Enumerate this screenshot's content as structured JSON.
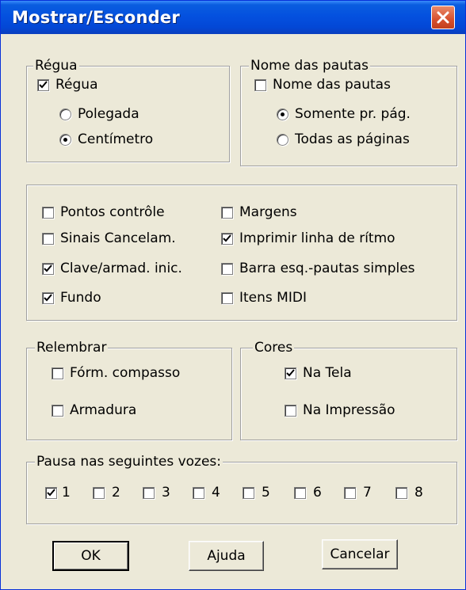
{
  "window": {
    "title": "Mostrar/Esconder"
  },
  "regua": {
    "legend": "Régua",
    "checkbox": {
      "label": "Régua",
      "checked": true
    },
    "options": [
      {
        "label": "Polegada",
        "selected": false
      },
      {
        "label": "Centímetro",
        "selected": true
      }
    ]
  },
  "nome_pautas": {
    "legend": "Nome das pautas",
    "checkbox": {
      "label": "Nome das pautas",
      "checked": false
    },
    "options": [
      {
        "label": "Somente pr. pág.",
        "selected": true
      },
      {
        "label": "Todas as páginas",
        "selected": false
      }
    ]
  },
  "display_options": [
    {
      "label": "Pontos contrôle",
      "checked": false
    },
    {
      "label": "Sinais Cancelam.",
      "checked": false
    },
    {
      "label": "Clave/armad. inic.",
      "checked": true
    },
    {
      "label": "Fundo",
      "checked": true
    },
    {
      "label": "Margens",
      "checked": false
    },
    {
      "label": "Imprimir linha de rítmo",
      "checked": true
    },
    {
      "label": "Barra esq.-pautas simples",
      "checked": false
    },
    {
      "label": "Itens MIDI",
      "checked": false
    }
  ],
  "relembrar": {
    "legend": "Relembrar",
    "items": [
      {
        "label": "Fórm. compasso",
        "checked": false
      },
      {
        "label": "Armadura",
        "checked": false
      }
    ]
  },
  "cores": {
    "legend": "Cores",
    "items": [
      {
        "label": "Na Tela",
        "checked": true
      },
      {
        "label": "Na Impressão",
        "checked": false
      }
    ]
  },
  "pausa": {
    "legend": "Pausa nas seguintes vozes:",
    "voices": [
      {
        "label": "1",
        "checked": true
      },
      {
        "label": "2",
        "checked": false
      },
      {
        "label": "3",
        "checked": false
      },
      {
        "label": "4",
        "checked": false
      },
      {
        "label": "5",
        "checked": false
      },
      {
        "label": "6",
        "checked": false
      },
      {
        "label": "7",
        "checked": false
      },
      {
        "label": "8",
        "checked": false
      }
    ]
  },
  "buttons": {
    "ok": "OK",
    "help": "Ajuda",
    "cancel": "Cancelar"
  },
  "colors": {
    "title_bar": "#0451df",
    "close_button": "#d6502e",
    "dialog_bg": "#ece9d8"
  }
}
